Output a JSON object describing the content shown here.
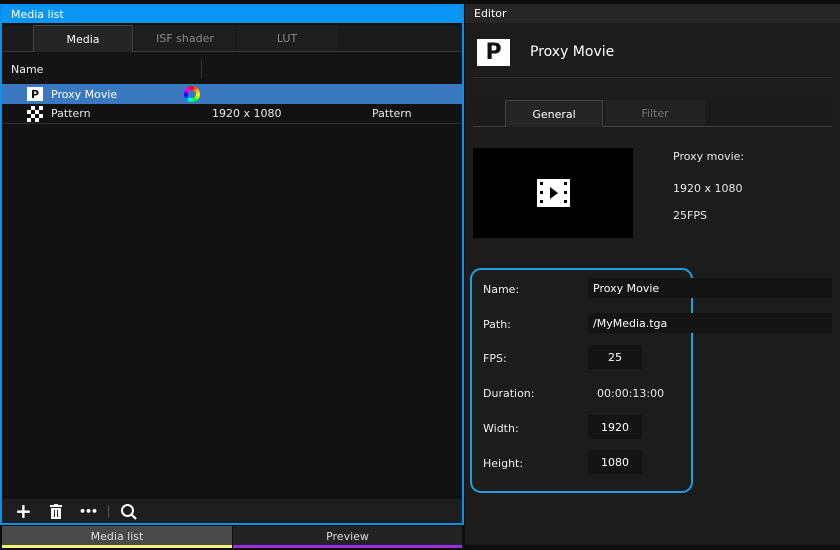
{
  "media_list": {
    "title": "Media list",
    "tabs": [
      {
        "label": "Media"
      },
      {
        "label": "ISF shader"
      },
      {
        "label": "LUT"
      }
    ],
    "column_header": "Name",
    "rows": [
      {
        "name": "Proxy Movie",
        "resolution": "",
        "type": "",
        "icon": "proxy-movie-icon"
      },
      {
        "name": "Pattern",
        "resolution": "1920 x 1080",
        "type": "Pattern",
        "icon": "checker-pattern-icon"
      }
    ],
    "toolbar": {
      "add": "+",
      "delete": "trash-icon",
      "more": "•••",
      "search": "search-icon"
    }
  },
  "bottom_tabs": [
    {
      "label": "Media list",
      "color": "#f2f27a"
    },
    {
      "label": "Preview",
      "color": "#9b2fe0"
    }
  ],
  "editor": {
    "title": "Editor",
    "media_name": "Proxy Movie",
    "tabs": [
      {
        "label": "General"
      },
      {
        "label": "Filter"
      }
    ],
    "info": {
      "kind": "Proxy movie:",
      "resolution": "1920 x 1080",
      "fps": "25FPS"
    },
    "fields": {
      "name": {
        "label": "Name:",
        "value": "Proxy Movie"
      },
      "path": {
        "label": "Path:",
        "value": "/MyMedia.tga"
      },
      "fps": {
        "label": "FPS:",
        "value": "25"
      },
      "duration": {
        "label": "Duration:",
        "value": "00:00:13:00"
      },
      "width": {
        "label": "Width:",
        "value": "1920"
      },
      "height": {
        "label": "Height:",
        "value": "1080"
      }
    }
  }
}
